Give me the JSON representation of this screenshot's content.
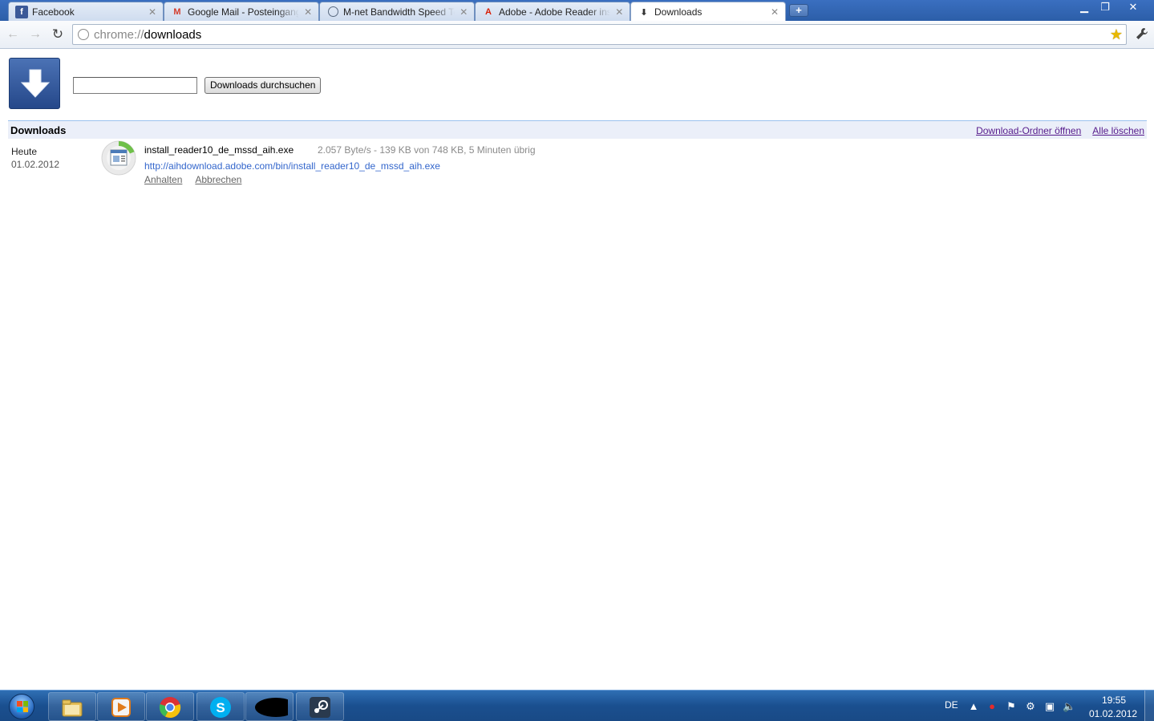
{
  "browser": {
    "tabs": [
      {
        "title": "Facebook",
        "icon": "facebook-icon",
        "active": false
      },
      {
        "title": "Google Mail - Posteingang",
        "icon": "gmail-icon",
        "active": false
      },
      {
        "title": "M-net Bandwidth Speed Te",
        "icon": "globe-icon",
        "active": false
      },
      {
        "title": "Adobe - Adobe Reader inst",
        "icon": "adobe-icon",
        "active": false
      },
      {
        "title": "Downloads",
        "icon": "download-icon",
        "active": true
      }
    ],
    "new_tab_label": "+",
    "omnibox": {
      "scheme": "chrome://",
      "host": "downloads"
    }
  },
  "downloads_page": {
    "search": {
      "value": "",
      "button_label": "Downloads durchsuchen"
    },
    "section": {
      "title": "Downloads",
      "open_folder_label": "Download-Ordner öffnen",
      "clear_all_label": "Alle löschen"
    },
    "groups": [
      {
        "day": "Heute",
        "date": "01.02.2012",
        "items": [
          {
            "filename": "install_reader10_de_mssd_aih.exe",
            "status": "2.057 Byte/s - 139 KB von 748 KB, 5 Minuten übrig",
            "url": "http://aihdownload.adobe.com/bin/install_reader10_de_mssd_aih.exe",
            "progress": 0.19,
            "actions": {
              "pause": "Anhalten",
              "cancel": "Abbrechen"
            }
          }
        ]
      }
    ]
  },
  "taskbar": {
    "pinned": [
      "start-orb",
      "explorer-icon",
      "media-player-icon",
      "chrome-icon",
      "skype-icon",
      "redacted-app-icon",
      "steam-icon"
    ],
    "tray": {
      "language": "DE",
      "time": "19:55",
      "date": "01.02.2012"
    }
  },
  "colors": {
    "link_visited": "#551a8b",
    "link": "#3366cc",
    "section_bg": "#ebeff9",
    "logo_blue": "#2f5aa0"
  }
}
